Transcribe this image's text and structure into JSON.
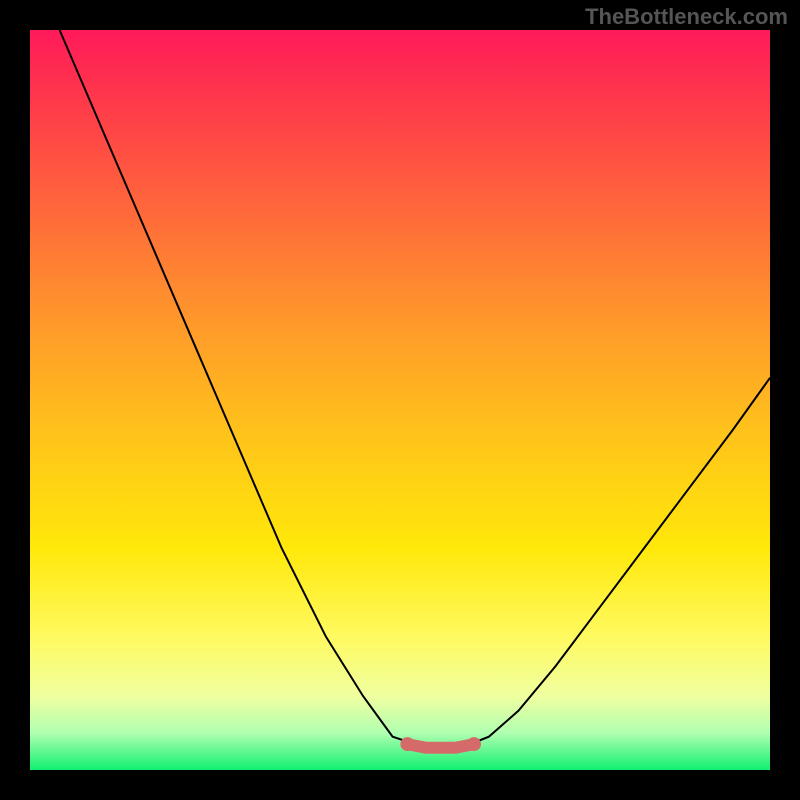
{
  "watermark": "TheBottleneck.com",
  "chart_data": {
    "type": "line",
    "title": "",
    "xlabel": "",
    "ylabel": "",
    "x_range_hint": [
      0,
      1
    ],
    "y_range_hint": [
      0,
      1
    ],
    "curve_points_normalized": [
      [
        0.04,
        0.0
      ],
      [
        0.1,
        0.14
      ],
      [
        0.16,
        0.28
      ],
      [
        0.22,
        0.42
      ],
      [
        0.28,
        0.56
      ],
      [
        0.34,
        0.7
      ],
      [
        0.4,
        0.82
      ],
      [
        0.45,
        0.9
      ],
      [
        0.49,
        0.955
      ],
      [
        0.52,
        0.965
      ],
      [
        0.545,
        0.97
      ],
      [
        0.57,
        0.97
      ],
      [
        0.595,
        0.965
      ],
      [
        0.62,
        0.955
      ],
      [
        0.66,
        0.92
      ],
      [
        0.71,
        0.86
      ],
      [
        0.77,
        0.78
      ],
      [
        0.83,
        0.7
      ],
      [
        0.89,
        0.62
      ],
      [
        0.95,
        0.54
      ],
      [
        1.0,
        0.47
      ]
    ],
    "flat_zone_markers_normalized": [
      [
        0.51,
        0.965
      ],
      [
        0.535,
        0.97
      ],
      [
        0.555,
        0.97
      ],
      [
        0.575,
        0.97
      ],
      [
        0.6,
        0.965
      ]
    ],
    "marker_color": "#d46a6a",
    "curve_color": "#000000",
    "background_gradient": [
      "#ff1a5a",
      "#ff6a3a",
      "#ffc41a",
      "#fffa60",
      "#10f070"
    ]
  }
}
